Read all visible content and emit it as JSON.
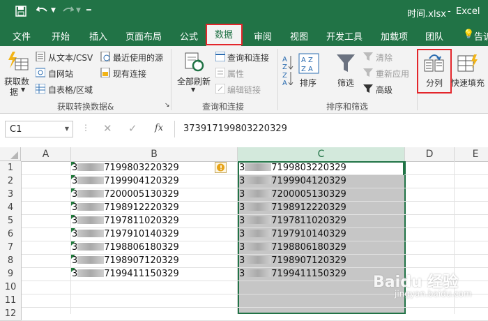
{
  "title_bar": {
    "filename": "时间.xlsx",
    "separator": "-",
    "app": "Excel"
  },
  "tabs": [
    "文件",
    "开始",
    "插入",
    "页面布局",
    "公式",
    "数据",
    "审阅",
    "视图",
    "开发工具",
    "加载项",
    "团队"
  ],
  "tell_me": "告诉",
  "ribbon": {
    "get_data": "获取数",
    "get_data2": "据",
    "from_text": "从文本/CSV",
    "from_web": "自网站",
    "from_table": "自表格/区域",
    "recent_sources": "最近使用的源",
    "existing_conn": "现有连接",
    "group_get": "获取转换数据&",
    "refresh_all": "全部刷新",
    "queries_conn": "查询和连接",
    "properties": "属性",
    "edit_links": "编辑链接",
    "group_queries": "查询和连接",
    "sort": "排序",
    "filter": "筛选",
    "clear": "清除",
    "reapply": "重新应用",
    "advanced": "高级",
    "group_sort": "排序和筛选",
    "text_to_columns": "分列",
    "flash_fill": "快速填充",
    "az_top": "A Z",
    "az_bot": "Z A"
  },
  "formula_bar": {
    "name_box": "C1",
    "fx": "fx",
    "value": "373917199803220329"
  },
  "columns": [
    "A",
    "B",
    "C",
    "D",
    "E"
  ],
  "rows": [
    "1",
    "2",
    "3",
    "4",
    "5",
    "6",
    "7",
    "8",
    "9",
    "10",
    "11",
    "12"
  ],
  "cells": [
    {
      "prefix": "3",
      "suffix": "7199803220329"
    },
    {
      "prefix": "3",
      "suffix": "7199904120329"
    },
    {
      "prefix": "3",
      "suffix": "7200005130329"
    },
    {
      "prefix": "3",
      "suffix": "7198912220329"
    },
    {
      "prefix": "3",
      "suffix": "7197811020329"
    },
    {
      "prefix": "3",
      "suffix": "7197910140329"
    },
    {
      "prefix": "3",
      "suffix": "7198806180329"
    },
    {
      "prefix": "3",
      "suffix": "7198907120329"
    },
    {
      "prefix": "3",
      "suffix": "7199411150329"
    }
  ],
  "warning_glyph": "!",
  "watermark": {
    "brand": "Baidu 经验",
    "url": "jingyan.baidu.com"
  },
  "colors": {
    "excel_green": "#217346",
    "highlight_red": "#e3262b",
    "selection_gray": "#c6c6c6"
  }
}
